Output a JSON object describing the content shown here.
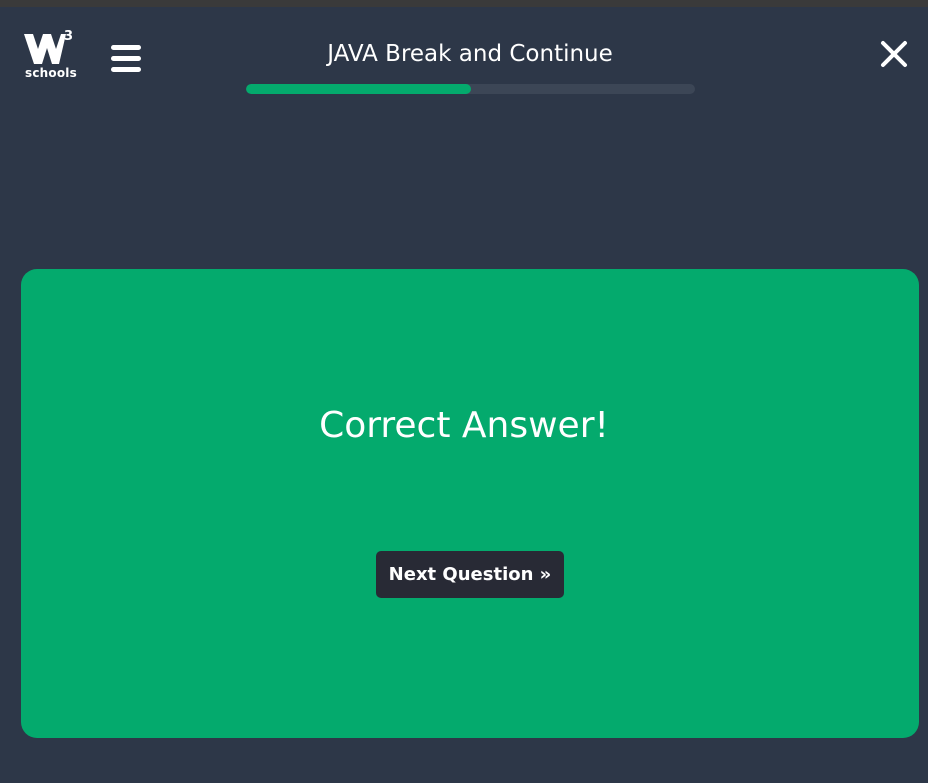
{
  "header": {
    "logo": {
      "superscript": "3",
      "wordmark": "schools"
    },
    "menu_icon": "hamburger-menu-icon",
    "title": "JAVA Break and Continue",
    "progress_fraction": 0.5,
    "close_icon": "close-icon"
  },
  "result": {
    "message": "Correct Answer!",
    "next_button_label": "Next Question »"
  },
  "colors": {
    "background": "#2d3748",
    "accent_green": "#04aa6d",
    "button_dark": "#282a35",
    "progress_track": "#3c4656",
    "text": "#ffffff"
  }
}
